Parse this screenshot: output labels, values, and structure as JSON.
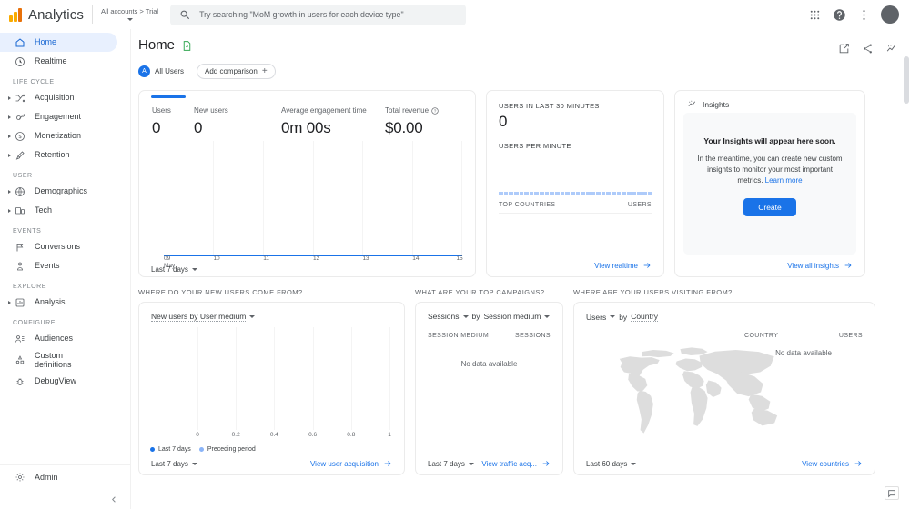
{
  "topbar": {
    "brand": "Analytics",
    "account_switcher": "All accounts > Trial",
    "search_placeholder": "Try searching \"MoM growth in users for each device type\"",
    "icons": {
      "apps": "apps-grid-icon",
      "help": "help-icon",
      "more": "more-vert-icon",
      "avatar": "avatar"
    }
  },
  "sidebar": {
    "items": [
      {
        "label": "Home",
        "icon": "home-icon",
        "selected": true,
        "expandable": false
      },
      {
        "label": "Realtime",
        "icon": "clock-icon",
        "selected": false,
        "expandable": false
      }
    ],
    "sections": [
      {
        "title": "LIFE CYCLE",
        "items": [
          {
            "label": "Acquisition",
            "icon": "acquisition-icon",
            "expandable": true
          },
          {
            "label": "Engagement",
            "icon": "engagement-icon",
            "expandable": true
          },
          {
            "label": "Monetization",
            "icon": "monetization-icon",
            "expandable": true
          },
          {
            "label": "Retention",
            "icon": "retention-icon",
            "expandable": true
          }
        ]
      },
      {
        "title": "USER",
        "items": [
          {
            "label": "Demographics",
            "icon": "globe-icon",
            "expandable": true
          },
          {
            "label": "Tech",
            "icon": "devices-icon",
            "expandable": true
          }
        ]
      },
      {
        "title": "EVENTS",
        "items": [
          {
            "label": "Conversions",
            "icon": "flag-icon",
            "expandable": false
          },
          {
            "label": "Events",
            "icon": "events-icon",
            "expandable": false
          }
        ]
      },
      {
        "title": "EXPLORE",
        "items": [
          {
            "label": "Analysis",
            "icon": "analysis-icon",
            "expandable": true
          }
        ]
      },
      {
        "title": "CONFIGURE",
        "items": [
          {
            "label": "Audiences",
            "icon": "audiences-icon",
            "expandable": false
          },
          {
            "label": "Custom definitions",
            "icon": "custom-definitions-icon",
            "expandable": false
          },
          {
            "label": "DebugView",
            "icon": "debug-icon",
            "expandable": false
          }
        ]
      }
    ],
    "admin": {
      "label": "Admin",
      "icon": "gear-icon"
    },
    "collapse": "collapse-chevron-icon"
  },
  "page": {
    "title": "Home",
    "title_icon": "report-icon",
    "head_icons": [
      "edit-icon",
      "share-icon",
      "insights-icon"
    ],
    "chips": {
      "all_users": "All Users",
      "all_users_badge": "A",
      "add_comparison": "Add comparison"
    }
  },
  "overview_card": {
    "metrics": [
      {
        "label": "Users",
        "value": "0"
      },
      {
        "label": "New users",
        "value": "0"
      },
      {
        "label": "Average engagement time",
        "value": "0m 00s"
      },
      {
        "label": "Total revenue",
        "value": "$0.00",
        "info": "help-icon"
      }
    ],
    "date_range": "Last 7 days"
  },
  "realtime_card": {
    "users_30min_label": "USERS IN LAST 30 MINUTES",
    "users_30min_value": "0",
    "per_minute_label": "USERS PER MINUTE",
    "table": {
      "col1": "TOP COUNTRIES",
      "col2": "USERS"
    },
    "link": "View realtime"
  },
  "insights_card": {
    "title": "Insights",
    "icon": "insights-icon",
    "heading": "Your Insights will appear here soon.",
    "body": "In the meantime, you can create new custom insights to monitor your most important metrics.",
    "learn_more": "Learn more",
    "create_button": "Create",
    "link": "View all insights"
  },
  "sections": {
    "acquisition": {
      "question": "WHERE DO YOUR NEW USERS COME FROM?",
      "dimension": "New users by User medium",
      "date_range": "Last 7 days",
      "link": "View user acquisition",
      "legend": [
        "Last 7 days",
        "Preceding period"
      ]
    },
    "campaigns": {
      "question": "WHAT ARE YOUR TOP CAMPAIGNS?",
      "metric": "Sessions",
      "by": "by",
      "dimension": "Session medium",
      "table": {
        "col1": "SESSION MEDIUM",
        "col2": "SESSIONS"
      },
      "empty": "No data available",
      "date_range": "Last 7 days",
      "link": "View traffic acq..."
    },
    "countries": {
      "question": "WHERE ARE YOUR USERS VISITING FROM?",
      "metric": "Users",
      "by": "by",
      "dimension": "Country",
      "table": {
        "col1": "COUNTRY",
        "col2": "USERS"
      },
      "empty": "No data available",
      "date_range": "Last 60 days",
      "link": "View countries"
    }
  },
  "chart_data": [
    {
      "type": "line",
      "title": "Users overview",
      "xlabel": "",
      "ylabel": "Users",
      "x": [
        "09 May",
        "10",
        "11",
        "12",
        "13",
        "14",
        "15"
      ],
      "series": [
        {
          "name": "Users",
          "values": [
            0,
            0,
            0,
            0,
            0,
            0,
            0
          ]
        }
      ],
      "ylim": [
        0,
        0
      ],
      "grid": true,
      "legend": "none"
    },
    {
      "type": "bar",
      "title": "New users by User medium",
      "xlabel": "",
      "ylabel": "",
      "categories": [],
      "tick_labels": [
        "0",
        "0.2",
        "0.4",
        "0.6",
        "0.8",
        "1"
      ],
      "series": [
        {
          "name": "Last 7 days",
          "values": [],
          "color": "#1a73e8"
        },
        {
          "name": "Preceding period",
          "values": [],
          "color": "#8ab4f8"
        }
      ],
      "xlim": [
        0,
        1
      ],
      "grid": true,
      "legend": "bottom-left"
    },
    {
      "type": "table",
      "title": "Sessions by Session medium",
      "columns": [
        "SESSION MEDIUM",
        "SESSIONS"
      ],
      "rows": [],
      "empty_text": "No data available"
    },
    {
      "type": "heatmap",
      "title": "Users by Country",
      "map": "world",
      "columns": [
        "COUNTRY",
        "USERS"
      ],
      "rows": [],
      "empty_text": "No data available"
    }
  ],
  "feedback_icon": "feedback-icon"
}
